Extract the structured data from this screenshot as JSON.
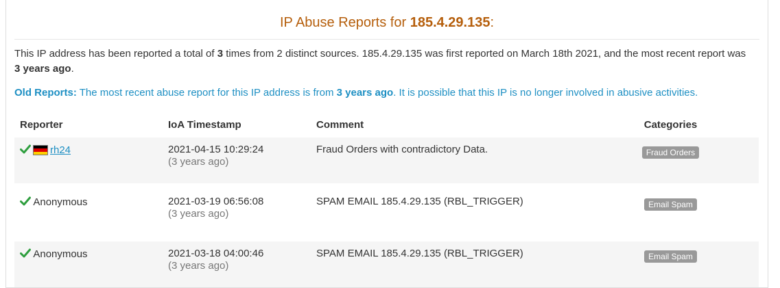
{
  "header": {
    "title_prefix": "IP Abuse Reports for ",
    "ip": "185.4.29.135",
    "title_suffix": ":"
  },
  "summary": {
    "part1": "This IP address has been reported a total of ",
    "count": "3",
    "part2": " times from 2 distinct sources. 185.4.29.135 was first reported on March 18th 2021, and the most recent report was ",
    "recent": "3 years ago",
    "part3": "."
  },
  "old_notice": {
    "label": "Old Reports:",
    "part1": " The most recent abuse report for this IP address is from ",
    "age": "3 years ago",
    "part2": ". It is possible that this IP is no longer involved in abusive activities."
  },
  "table": {
    "headers": {
      "reporter": "Reporter",
      "timestamp": "IoA Timestamp",
      "comment": "Comment",
      "categories": "Categories"
    },
    "rows": [
      {
        "reporter": "rh24",
        "timestamp": "2021-04-15 10:29:24",
        "relative": "(3 years ago)",
        "comment": "Fraud Orders with contradictory Data.",
        "category": "Fraud Orders",
        "flag_icon": "germany-flag-icon"
      },
      {
        "reporter": "Anonymous",
        "timestamp": "2021-03-19 06:56:08",
        "relative": "(3 years ago)",
        "comment": "SPAM EMAIL 185.4.29.135 (RBL_TRIGGER)",
        "category": "Email Spam"
      },
      {
        "reporter": "Anonymous",
        "timestamp": "2021-03-18 04:00:46",
        "relative": "(3 years ago)",
        "comment": "SPAM EMAIL 185.4.29.135 (RBL_TRIGGER)",
        "category": "Email Spam"
      }
    ]
  },
  "colors": {
    "title": "#b55e0b",
    "link": "#1d8fc3",
    "check": "#2e9e3e",
    "badge": "#999999"
  }
}
